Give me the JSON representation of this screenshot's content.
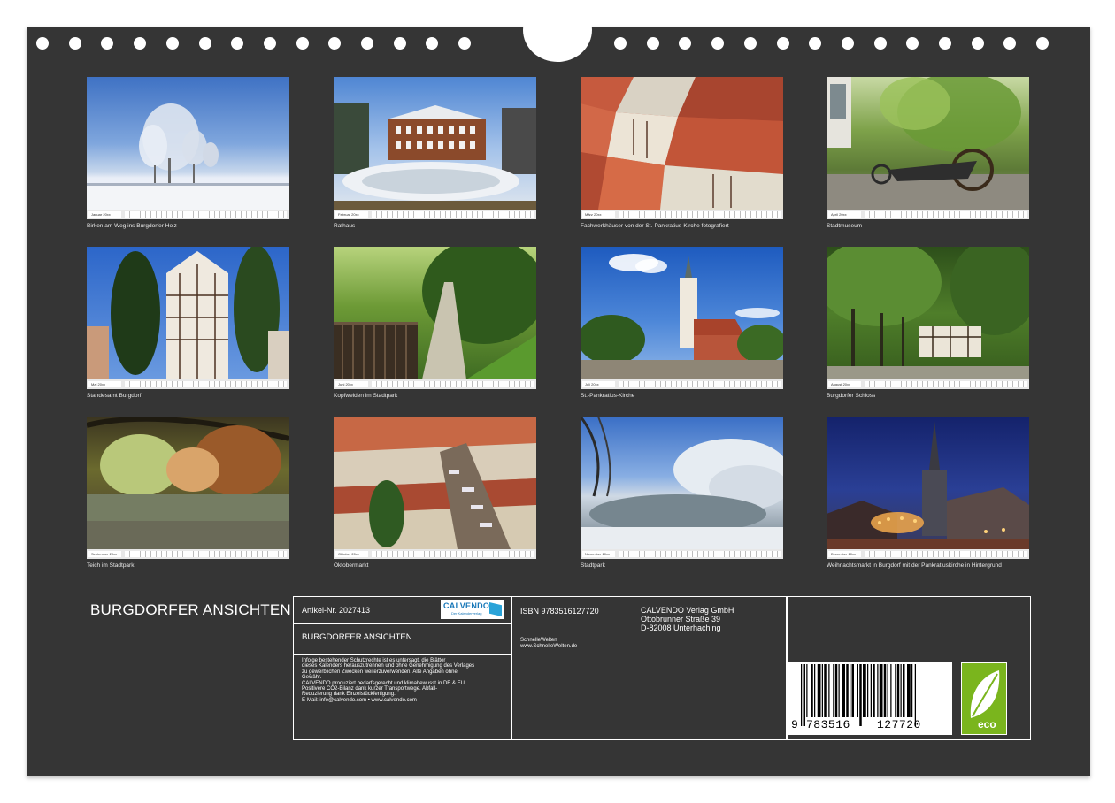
{
  "thumbnails": [
    {
      "month": "Januar 20xx",
      "caption": "Birken am Weg ins Burgdorfer Holz"
    },
    {
      "month": "Februar 20xx",
      "caption": "Rathaus"
    },
    {
      "month": "März 20xx",
      "caption": "Fachwerkhäuser von der St.-Pankratius-Kirche fotografiert"
    },
    {
      "month": "April 20xx",
      "caption": "Stadtmuseum"
    },
    {
      "month": "Mai 20xx",
      "caption": "Standesamt Burgdorf"
    },
    {
      "month": "Juni 20xx",
      "caption": "Kopfweiden im Stadtpark"
    },
    {
      "month": "Juli 20xx",
      "caption": "St.-Pankratius-Kirche"
    },
    {
      "month": "August 20xx",
      "caption": "Burgdorfer Schloss"
    },
    {
      "month": "September 20xx",
      "caption": "Teich im Stadtpark"
    },
    {
      "month": "Oktober 20xx",
      "caption": "Oktobermarkt"
    },
    {
      "month": "November 20xx",
      "caption": "Stadtpark"
    },
    {
      "month": "Dezember 20xx",
      "caption": "Weihnachtsmarkt in Burgdorf mit der Pankratiuskirche in Hintergrund"
    }
  ],
  "title": "BURGDORFER ANSICHTEN",
  "info": {
    "article": "Artikel-Nr. 2027413",
    "logo_name": "CALVENDO",
    "logo_sub": "Der Kalenderverlag",
    "box_title": "BURGDORFER ANSICHTEN",
    "legal": [
      "Infolge bestehender Schutzrechte ist es untersagt, die Blätter",
      "dieses Kalenders herauszutrennen und ohne Genehmigung des Verlages",
      "zu gewerblichen Zwecken weiterzuverwenden. Alle Angaben ohne",
      "Gewähr.",
      "CALVENDO produziert bedarfsgerecht und klimabewusst in DE & EU.",
      "Positivere CO2-Bilanz dank kurzer Transportwege. Abfall-",
      "Reduzierung dank Einzelstückfertigung.",
      "E-Mail: info@calvendo.com • www.calvendo.com"
    ],
    "isbn": "ISBN 9783516127720",
    "author": "SchnelleWelten",
    "author_url": "www.SchnelleWelten.de",
    "publisher": [
      "CALVENDO Verlag GmbH",
      "Ottobrunner Straße 39",
      "D-82008 Unterhaching"
    ],
    "barcode_digits": [
      "9",
      "783516",
      "127720"
    ],
    "eco_label": "eco"
  }
}
